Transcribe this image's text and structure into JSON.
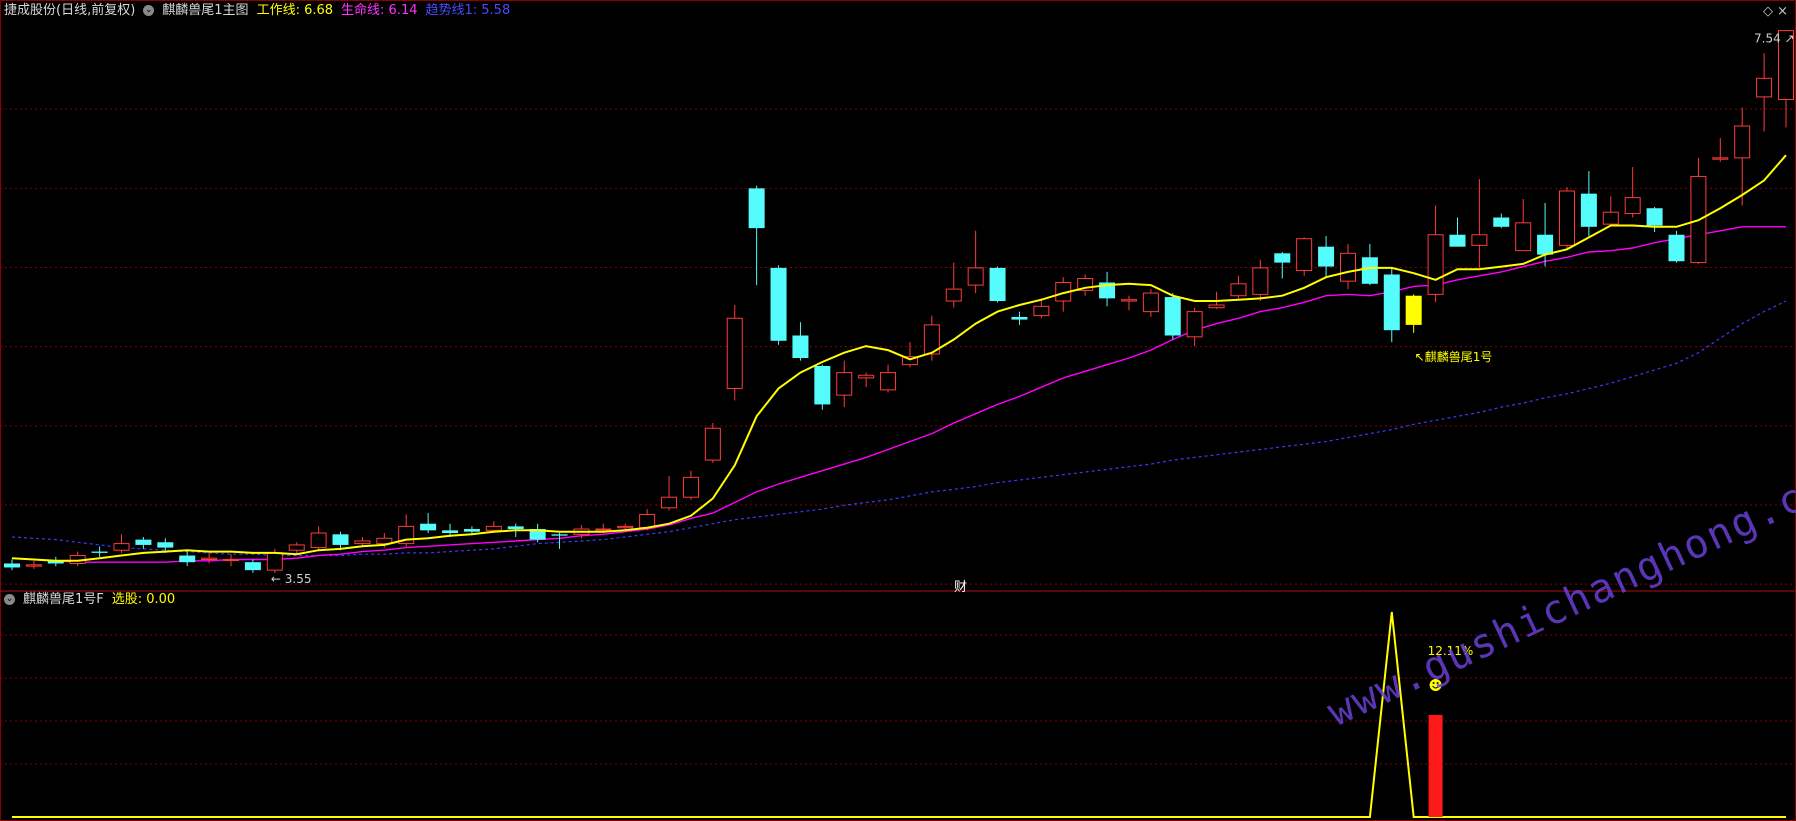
{
  "header": {
    "stock": "捷成股份(日线,前复权)",
    "indicator": "麒麟兽尾1主图",
    "work_line": "工作线: 6.68",
    "life_line": "生命线: 6.14",
    "trend_line": "趋势线1: 5.58"
  },
  "sub_header": {
    "indicator": "麒麟兽尾1号F",
    "select": "选股: 0.00"
  },
  "center_label": "财",
  "watermark": "www.gushichanghong.com",
  "colors": {
    "up": "#ff3b3b",
    "down": "#54fcfc",
    "work_line": "#ffff00",
    "life_line": "#ff00ff",
    "trend_line": "#3a3aff",
    "signal": "#ffff00",
    "grid": "#8b0000"
  },
  "chart_data": {
    "type": "candlestick",
    "price_range": [
      3.4,
      7.7
    ],
    "max_label": "7.54",
    "min_label": "3.55",
    "signal_label": "麒麟兽尾1号",
    "sub_value_label": "12.11%",
    "candles": [
      [
        3.6,
        3.57,
        3.63,
        3.55
      ],
      [
        3.58,
        3.59,
        3.62,
        3.56
      ],
      [
        3.62,
        3.6,
        3.65,
        3.58
      ],
      [
        3.6,
        3.66,
        3.69,
        3.58
      ],
      [
        3.69,
        3.68,
        3.73,
        3.65
      ],
      [
        3.7,
        3.75,
        3.82,
        3.68
      ],
      [
        3.78,
        3.74,
        3.8,
        3.71
      ],
      [
        3.76,
        3.72,
        3.79,
        3.68
      ],
      [
        3.66,
        3.61,
        3.7,
        3.58
      ],
      [
        3.63,
        3.64,
        3.68,
        3.6
      ],
      [
        3.63,
        3.63,
        3.67,
        3.58
      ],
      [
        3.61,
        3.55,
        3.63,
        3.53
      ],
      [
        3.55,
        3.68,
        3.71,
        3.53
      ],
      [
        3.7,
        3.74,
        3.76,
        3.67
      ],
      [
        3.72,
        3.83,
        3.88,
        3.7
      ],
      [
        3.82,
        3.74,
        3.84,
        3.7
      ],
      [
        3.75,
        3.77,
        3.8,
        3.73
      ],
      [
        3.75,
        3.79,
        3.83,
        3.72
      ],
      [
        3.75,
        3.88,
        3.97,
        3.72
      ],
      [
        3.9,
        3.85,
        3.98,
        3.83
      ],
      [
        3.85,
        3.83,
        3.9,
        3.8
      ],
      [
        3.86,
        3.84,
        3.88,
        3.82
      ],
      [
        3.85,
        3.88,
        3.92,
        3.83
      ],
      [
        3.88,
        3.86,
        3.9,
        3.8
      ],
      [
        3.86,
        3.78,
        3.9,
        3.76
      ],
      [
        3.82,
        3.81,
        3.83,
        3.71
      ],
      [
        3.82,
        3.86,
        3.89,
        3.79
      ],
      [
        3.86,
        3.86,
        3.9,
        3.83
      ],
      [
        3.87,
        3.88,
        3.9,
        3.84
      ],
      [
        3.87,
        3.97,
        4.01,
        3.85
      ],
      [
        4.02,
        4.1,
        4.26,
        4.0
      ],
      [
        4.1,
        4.25,
        4.3,
        4.08
      ],
      [
        4.38,
        4.62,
        4.66,
        4.36
      ],
      [
        4.92,
        5.45,
        5.55,
        4.83
      ],
      [
        6.43,
        6.13,
        6.45,
        5.7
      ],
      [
        5.83,
        5.28,
        5.85,
        5.25
      ],
      [
        5.32,
        5.15,
        5.42,
        5.13
      ],
      [
        5.09,
        4.8,
        5.1,
        4.76
      ],
      [
        4.87,
        5.04,
        5.13,
        4.78
      ],
      [
        5.0,
        5.02,
        5.04,
        4.93
      ],
      [
        4.91,
        5.04,
        5.1,
        4.89
      ],
      [
        5.1,
        5.16,
        5.27,
        5.08
      ],
      [
        5.18,
        5.4,
        5.47,
        5.13
      ],
      [
        5.58,
        5.67,
        5.87,
        5.53
      ],
      [
        5.7,
        5.83,
        6.11,
        5.64
      ],
      [
        5.83,
        5.58,
        5.84,
        5.57
      ],
      [
        5.46,
        5.44,
        5.5,
        5.4
      ],
      [
        5.47,
        5.54,
        5.6,
        5.45
      ],
      [
        5.58,
        5.72,
        5.76,
        5.5
      ],
      [
        5.66,
        5.75,
        5.78,
        5.62
      ],
      [
        5.72,
        5.6,
        5.8,
        5.54
      ],
      [
        5.58,
        5.59,
        5.62,
        5.51
      ],
      [
        5.5,
        5.64,
        5.67,
        5.46
      ],
      [
        5.61,
        5.32,
        5.64,
        5.29
      ],
      [
        5.31,
        5.5,
        5.53,
        5.24
      ],
      [
        5.53,
        5.55,
        5.65,
        5.52
      ],
      [
        5.62,
        5.71,
        5.77,
        5.6
      ],
      [
        5.63,
        5.83,
        5.89,
        5.58
      ],
      [
        5.94,
        5.87,
        5.95,
        5.75
      ],
      [
        5.81,
        6.05,
        6.06,
        5.77
      ],
      [
        5.99,
        5.84,
        6.07,
        5.76
      ],
      [
        5.73,
        5.94,
        6.01,
        5.67
      ],
      [
        5.91,
        5.71,
        6.01,
        5.7
      ],
      [
        5.78,
        5.36,
        5.83,
        5.27
      ],
      [
        5.4,
        5.62,
        5.63,
        5.34
      ],
      [
        5.63,
        6.08,
        6.3,
        5.57
      ],
      [
        6.08,
        5.99,
        6.21,
        5.99
      ],
      [
        6.0,
        6.08,
        6.5,
        5.83
      ],
      [
        6.21,
        6.14,
        6.24,
        6.13
      ],
      [
        5.96,
        6.17,
        6.35,
        5.96
      ],
      [
        6.08,
        5.93,
        6.32,
        5.84
      ],
      [
        6.0,
        6.41,
        6.44,
        5.98
      ],
      [
        6.39,
        6.14,
        6.56,
        6.07
      ],
      [
        6.16,
        6.25,
        6.37,
        6.15
      ],
      [
        6.24,
        6.36,
        6.59,
        6.21
      ],
      [
        6.28,
        6.15,
        6.29,
        6.1
      ],
      [
        6.08,
        5.88,
        6.11,
        5.87
      ],
      [
        5.87,
        6.52,
        6.66,
        5.86
      ],
      [
        6.65,
        6.66,
        6.81,
        6.63
      ],
      [
        6.66,
        6.9,
        7.04,
        6.3
      ],
      [
        7.12,
        7.26,
        7.45,
        6.86
      ],
      [
        7.1,
        7.62,
        7.62,
        6.89
      ]
    ],
    "ma_work": [
      3.64,
      3.63,
      3.62,
      3.62,
      3.64,
      3.66,
      3.68,
      3.69,
      3.7,
      3.69,
      3.69,
      3.68,
      3.68,
      3.67,
      3.7,
      3.71,
      3.73,
      3.74,
      3.78,
      3.79,
      3.81,
      3.82,
      3.84,
      3.85,
      3.85,
      3.84,
      3.84,
      3.84,
      3.85,
      3.87,
      3.9,
      3.96,
      4.09,
      4.34,
      4.71,
      4.92,
      5.04,
      5.12,
      5.19,
      5.24,
      5.21,
      5.14,
      5.19,
      5.29,
      5.41,
      5.5,
      5.55,
      5.59,
      5.64,
      5.68,
      5.7,
      5.71,
      5.7,
      5.62,
      5.58,
      5.58,
      5.59,
      5.6,
      5.62,
      5.68,
      5.76,
      5.8,
      5.83,
      5.83,
      5.79,
      5.74,
      5.82,
      5.82,
      5.84,
      5.86,
      5.93,
      5.97,
      6.06,
      6.15,
      6.15,
      6.14,
      6.14,
      6.19,
      6.28,
      6.38,
      6.49,
      6.68
    ],
    "ma_life": [
      3.64,
      3.63,
      3.62,
      3.61,
      3.61,
      3.61,
      3.61,
      3.61,
      3.62,
      3.62,
      3.63,
      3.63,
      3.63,
      3.64,
      3.66,
      3.67,
      3.69,
      3.7,
      3.72,
      3.73,
      3.74,
      3.75,
      3.76,
      3.77,
      3.78,
      3.79,
      3.81,
      3.82,
      3.84,
      3.86,
      3.89,
      3.94,
      3.98,
      4.06,
      4.14,
      4.2,
      4.25,
      4.3,
      4.35,
      4.4,
      4.46,
      4.52,
      4.58,
      4.66,
      4.73,
      4.8,
      4.86,
      4.93,
      5.0,
      5.05,
      5.1,
      5.15,
      5.21,
      5.29,
      5.36,
      5.41,
      5.45,
      5.5,
      5.53,
      5.57,
      5.62,
      5.63,
      5.62,
      5.65,
      5.69,
      5.7,
      5.74,
      5.77,
      5.8,
      5.84,
      5.88,
      5.91,
      5.95,
      5.96,
      5.98,
      6.02,
      6.05,
      6.08,
      6.11,
      6.14,
      6.14,
      6.14
    ],
    "ma_trend": [
      3.8,
      3.79,
      3.78,
      3.76,
      3.74,
      3.72,
      3.71,
      3.7,
      3.69,
      3.68,
      3.67,
      3.67,
      3.66,
      3.66,
      3.66,
      3.66,
      3.67,
      3.67,
      3.68,
      3.68,
      3.69,
      3.7,
      3.71,
      3.73,
      3.75,
      3.76,
      3.77,
      3.78,
      3.8,
      3.82,
      3.84,
      3.87,
      3.9,
      3.93,
      3.95,
      3.97,
      3.99,
      4.01,
      4.04,
      4.06,
      4.08,
      4.11,
      4.14,
      4.16,
      4.18,
      4.21,
      4.23,
      4.25,
      4.27,
      4.29,
      4.31,
      4.33,
      4.35,
      4.38,
      4.4,
      4.42,
      4.44,
      4.46,
      4.48,
      4.5,
      4.52,
      4.55,
      4.58,
      4.61,
      4.65,
      4.68,
      4.71,
      4.74,
      4.78,
      4.81,
      4.85,
      4.88,
      4.92,
      4.96,
      5.01,
      5.06,
      5.11,
      5.19,
      5.3,
      5.41,
      5.5,
      5.58
    ],
    "signal_index": 64,
    "sub_indicator_values": [
      0,
      0,
      0,
      0,
      0,
      0,
      0,
      0,
      0,
      0,
      0,
      0,
      0,
      0,
      0,
      0,
      0,
      0,
      0,
      0,
      0,
      0,
      0,
      0,
      0,
      0,
      0,
      0,
      0,
      0,
      0,
      0,
      0,
      0,
      0,
      0,
      0,
      0,
      0,
      0,
      0,
      0,
      0,
      0,
      0,
      0,
      0,
      0,
      0,
      0,
      0,
      0,
      0,
      0,
      0,
      0,
      0,
      0,
      0,
      0,
      0,
      0,
      0,
      1,
      0,
      0,
      0,
      0,
      0,
      0,
      0,
      0,
      0,
      0,
      0,
      0,
      0,
      0,
      0,
      0,
      0,
      0
    ]
  }
}
